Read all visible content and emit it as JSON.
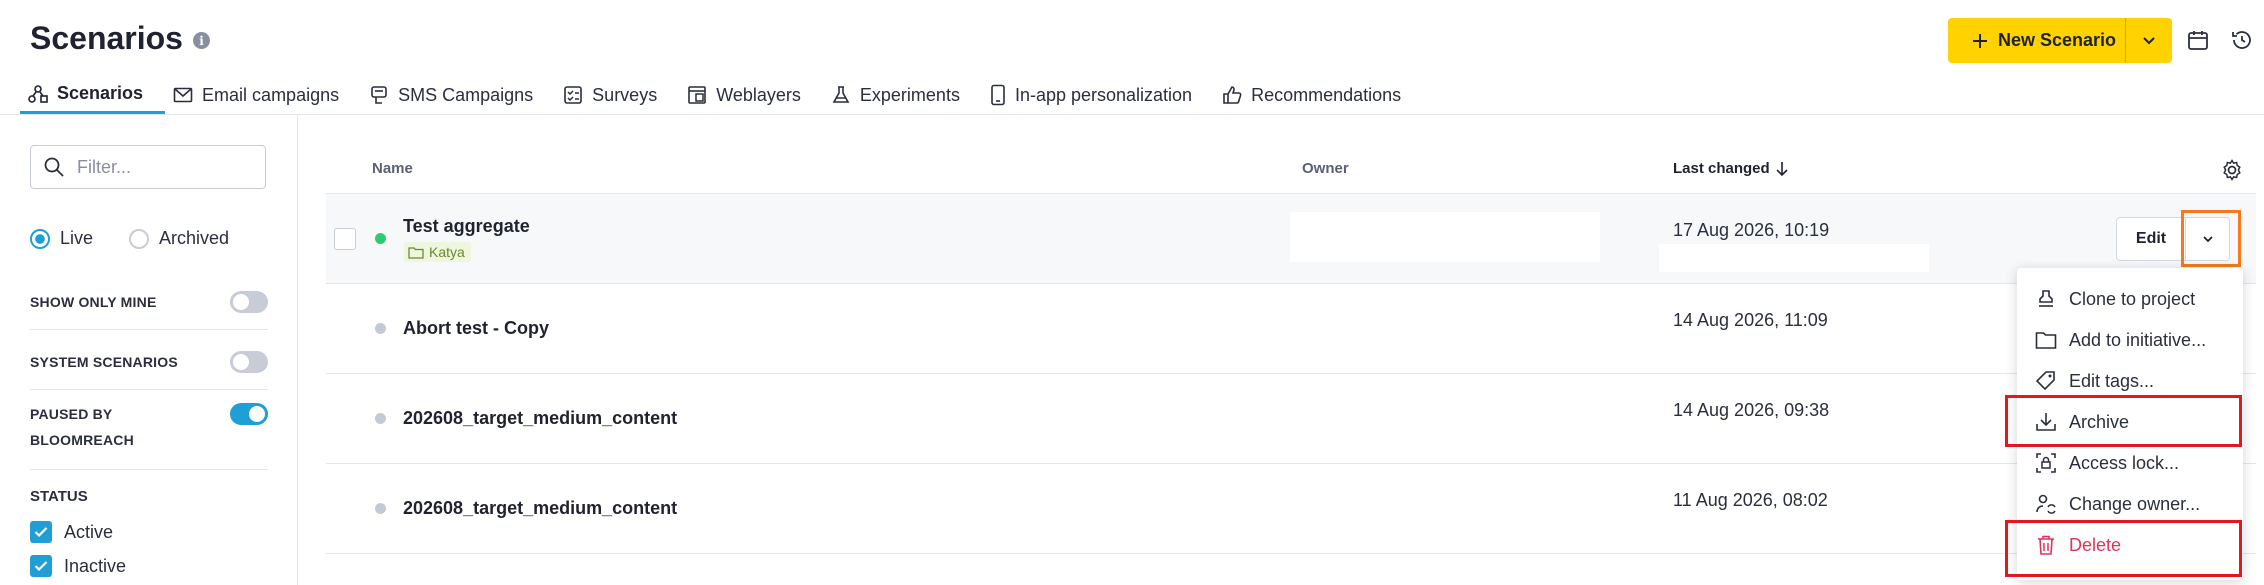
{
  "header": {
    "title": "Scenarios",
    "info_glyph": "i",
    "new_button_label": "New Scenario",
    "accent_color": "#ffd200"
  },
  "tabs": [
    {
      "label": "Scenarios",
      "icon": "scenario-icon",
      "active": true
    },
    {
      "label": "Email campaigns",
      "icon": "envelope-icon"
    },
    {
      "label": "SMS Campaigns",
      "icon": "sms-icon"
    },
    {
      "label": "Surveys",
      "icon": "checklist-icon"
    },
    {
      "label": "Weblayers",
      "icon": "weblayer-icon"
    },
    {
      "label": "Experiments",
      "icon": "flask-icon"
    },
    {
      "label": "In-app personalization",
      "icon": "phone-icon"
    },
    {
      "label": "Recommendations",
      "icon": "thumbs-up-icon"
    }
  ],
  "sidebar": {
    "filter_placeholder": "Filter...",
    "radio_live": "Live",
    "radio_archived": "Archived",
    "show_only_mine": "SHOW ONLY MINE",
    "system_scenarios": "SYSTEM SCENARIOS",
    "paused_by_line1": "PAUSED BY",
    "paused_by_line2": "BLOOMREACH",
    "status_title": "STATUS",
    "status_active": "Active",
    "status_inactive": "Inactive"
  },
  "table": {
    "col_name": "Name",
    "col_owner": "Owner",
    "col_last_changed": "Last changed",
    "rows": [
      {
        "name": "Test aggregate",
        "tag": "Katya",
        "date": "17 Aug 2026, 10:19",
        "live": true
      },
      {
        "name": "Abort test - Copy",
        "date": "14 Aug 2026, 11:09",
        "live": false
      },
      {
        "name": "202608_target_medium_content",
        "date": "14 Aug 2026, 09:38",
        "live": false
      },
      {
        "name": "202608_target_medium_content",
        "date": "11 Aug 2026, 08:02",
        "live": false
      }
    ],
    "edit_label": "Edit"
  },
  "menu": {
    "clone": "Clone to project",
    "add_initiative": "Add to initiative...",
    "edit_tags": "Edit tags...",
    "archive": "Archive",
    "access_lock": "Access lock...",
    "change_owner": "Change owner...",
    "delete": "Delete"
  }
}
